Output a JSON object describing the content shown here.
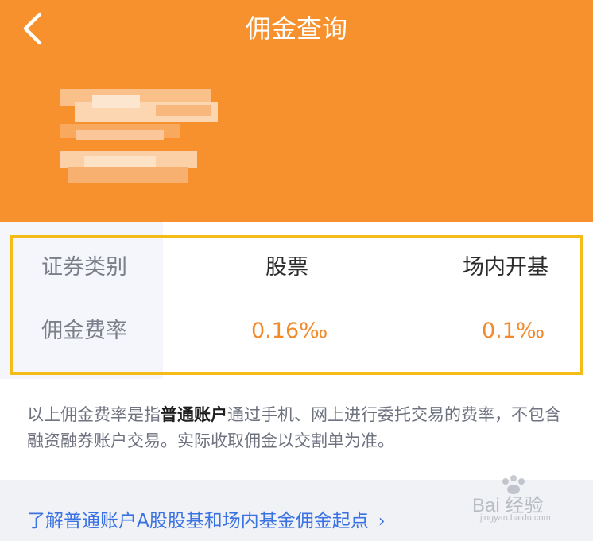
{
  "header": {
    "title": "佣金查询",
    "back_icon": "chevron-left-icon",
    "background": "#f7912e"
  },
  "table": {
    "row_labels": [
      "证券类别",
      "佣金费率"
    ],
    "columns": [
      {
        "name": "股票",
        "rate": "0.16‰"
      },
      {
        "name": "场内开基",
        "rate": "0.1‰"
      }
    ],
    "value_color": "#f28a2c",
    "highlight_color": "#f5bb16"
  },
  "note": {
    "prefix": "以上佣金费率是指",
    "bold": "普通账户",
    "suffix": "通过手机、网上进行委托交易的费率，不包含融资融券账户交易。实际收取佣金以交割单为准。"
  },
  "link": {
    "text": "了解普通账户A股股基和场内基金佣金起点",
    "color": "#3b72e3"
  },
  "watermark": {
    "text": "Bai 经验",
    "subtext": "jingyan.baidu.com"
  }
}
